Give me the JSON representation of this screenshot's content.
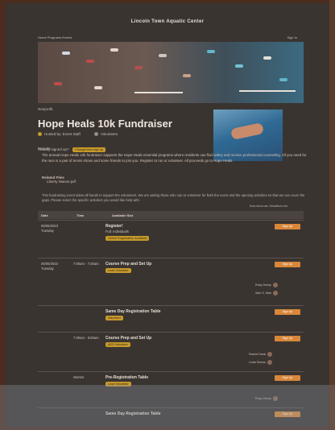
{
  "site": {
    "title": "Lincoln Town Aquatic Center"
  },
  "nav": {
    "left": "Home   Programs   Events",
    "right": "Sign In"
  },
  "event": {
    "kicker": "Nonprofit",
    "title": "Hope Heals 10k Fundraiser",
    "host": "Hosted by: Event Staff",
    "host_count": "Volunteers",
    "already_signed": "Already signed up?",
    "already_pill": "Change/view sign up",
    "reports_label": "Reports",
    "description": "The annual Hope Heals 10k fundraiser supports the Hope Heals essential programs where residents can find safety and receive professional counseling. All you need for the race is a pair of tennis shoes and some friends to join you. Register to run or volunteer. All proceeds go to Hope Heals.",
    "links_label": "Related Files",
    "links_item": "Liberty Waiver.pdf",
    "note": "This fundraising event takes all hands to support the volunteers. We are asking those who can to volunteer for both the event and the opening activities so that we can cover the gaps. Please select the specific activities you would like help with.",
    "showing": "Now show as: Headlines list"
  },
  "table": {
    "headers": [
      "Date",
      "Time",
      "Available Slot"
    ],
    "rows": [
      {
        "date": "06/06/2023",
        "day": "Tuesday",
        "time": "",
        "title": "Register!",
        "sub": "Full: Individuals",
        "pill": "Online Registration Available",
        "signup": "Sign Up"
      },
      {
        "date": "06/06/2023",
        "day": "Tuesday",
        "time": "7:00am - 7:30am",
        "title": "Course Prep and Set Up",
        "pill": "Lead Volunteer",
        "signup": "Sign Up",
        "person1": "Ruby Jimmy",
        "person2": "Sam S. Wan"
      },
      {
        "date": "",
        "day": "",
        "time": "",
        "title": "Same Day Registration Table",
        "pill": "Volunteer",
        "signup": "Sign Up"
      },
      {
        "date": "",
        "day": "",
        "time": "7:30am - 8:00am",
        "title": "Course Prep and Set Up",
        "pill": "AED Volunteer",
        "signup": "Sign Up",
        "person1": "Rachel Davis",
        "person2": "Linda Simms"
      },
      {
        "date": "",
        "day": "",
        "time": "Worker",
        "title": "Pre-Registration Table",
        "pill": "Lead Volunteer",
        "signup": "Sign Up",
        "person1": "Ruby Jimmy"
      },
      {
        "date": "",
        "day": "",
        "time": "",
        "title": "Same Day Registration Table",
        "pill": "",
        "signup": "Sign Up"
      }
    ]
  },
  "colors": {
    "accent": "#d8873a",
    "danger": "#b33a30",
    "pill": "#c79a2a"
  }
}
